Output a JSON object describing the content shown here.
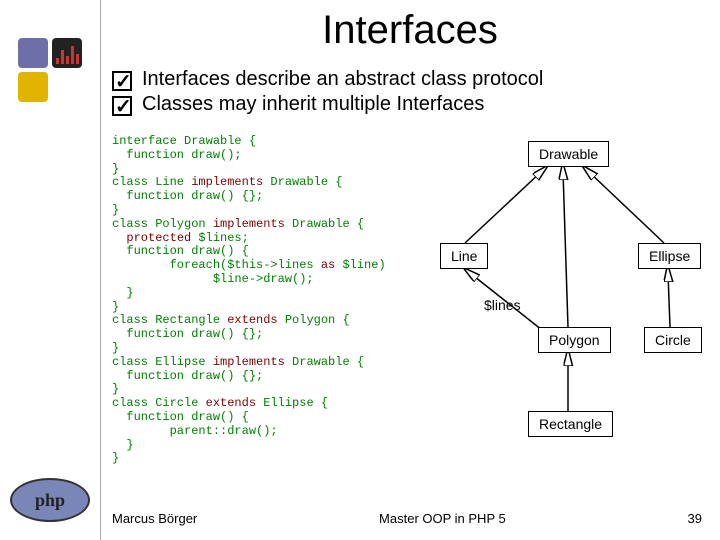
{
  "title": "Interfaces",
  "bullets": [
    "Interfaces describe an abstract class protocol",
    "Classes may inherit multiple Interfaces"
  ],
  "code": {
    "lines": [
      {
        "t": "interface Drawable {",
        "kw": []
      },
      {
        "t": "  function draw();",
        "kw": []
      },
      {
        "t": "}",
        "kw": []
      },
      {
        "t": "class Line implements Drawable {",
        "kw": [
          "implements"
        ]
      },
      {
        "t": "  function draw() {};",
        "kw": []
      },
      {
        "t": "}",
        "kw": []
      },
      {
        "t": "class Polygon implements Drawable {",
        "kw": [
          "implements"
        ]
      },
      {
        "t": "  protected $lines;",
        "kw": [
          "protected"
        ]
      },
      {
        "t": "  function draw() {",
        "kw": []
      },
      {
        "t": "        foreach($this->lines as $line)",
        "kw": [
          "as"
        ]
      },
      {
        "t": "              $line->draw();",
        "kw": []
      },
      {
        "t": "  }",
        "kw": []
      },
      {
        "t": "}",
        "kw": []
      },
      {
        "t": "class Rectangle extends Polygon {",
        "kw": [
          "extends"
        ]
      },
      {
        "t": "  function draw() {};",
        "kw": []
      },
      {
        "t": "}",
        "kw": []
      },
      {
        "t": "class Ellipse implements Drawable {",
        "kw": [
          "implements"
        ]
      },
      {
        "t": "  function draw() {};",
        "kw": []
      },
      {
        "t": "}",
        "kw": []
      },
      {
        "t": "class Circle extends Ellipse {",
        "kw": [
          "extends"
        ]
      },
      {
        "t": "  function draw() {",
        "kw": []
      },
      {
        "t": "        parent::draw();",
        "kw": []
      },
      {
        "t": "  }",
        "kw": []
      },
      {
        "t": "}",
        "kw": []
      }
    ]
  },
  "diagram": {
    "drawable": "Drawable",
    "line": "Line",
    "ellipse": "Ellipse",
    "polygon": "Polygon",
    "circle": "Circle",
    "rectangle": "Rectangle",
    "lines_label": "$lines"
  },
  "footer": {
    "author": "Marcus Börger",
    "center": "Master OOP in PHP 5",
    "page": "39"
  },
  "php_logo_text": "php"
}
